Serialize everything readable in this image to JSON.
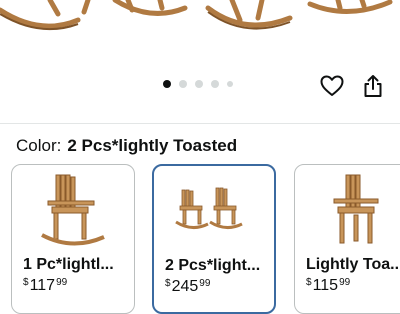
{
  "hero": {
    "image": "wooden-rocking-chairs-photo"
  },
  "carousel": {
    "dot_count": 5,
    "active_index": 0
  },
  "actions": {
    "favorite_icon": "heart-icon",
    "share_icon": "share-icon"
  },
  "variation": {
    "label": "Color:",
    "selected_value": "2 Pcs*lightly Toasted"
  },
  "options": [
    {
      "title": "1 Pc*lightl...",
      "currency": "$",
      "dollars": "117",
      "cents": "99",
      "selected": false
    },
    {
      "title": "2 Pcs*light...",
      "currency": "$",
      "dollars": "245",
      "cents": "99",
      "selected": true
    },
    {
      "title": "Lightly Toa...",
      "currency": "$",
      "dollars": "115",
      "cents": "99",
      "selected": false
    }
  ],
  "colors": {
    "selected_border": "#3b6aa0",
    "wood": "#c8955a",
    "wood_dark": "#8a5a2b"
  }
}
